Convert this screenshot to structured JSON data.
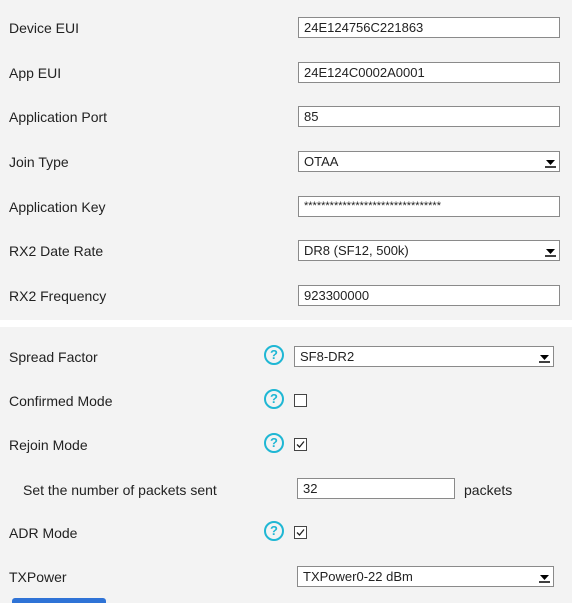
{
  "lorawan": {
    "device_eui": {
      "label": "Device EUI",
      "value": "24E124756C221863"
    },
    "app_eui": {
      "label": "App EUI",
      "value": "24E124C0002A0001"
    },
    "application_port": {
      "label": "Application Port",
      "value": "85"
    },
    "join_type": {
      "label": "Join Type",
      "value": "OTAA"
    },
    "application_key": {
      "label": "Application Key",
      "value": "********************************"
    },
    "rx2_data_rate": {
      "label": "RX2 Date Rate",
      "value": "DR8 (SF12, 500k)"
    },
    "rx2_frequency": {
      "label": "RX2 Frequency",
      "value": "923300000"
    }
  },
  "advanced": {
    "spread_factor": {
      "label": "Spread Factor",
      "value": "SF8-DR2",
      "help": "?"
    },
    "confirmed_mode": {
      "label": "Confirmed Mode",
      "checked": false,
      "help": "?"
    },
    "rejoin_mode": {
      "label": "Rejoin Mode",
      "checked": true,
      "help": "?"
    },
    "packets_sent": {
      "label": "Set the number of packets sent",
      "value": "32",
      "unit": "packets"
    },
    "adr_mode": {
      "label": "ADR Mode",
      "checked": true,
      "help": "?"
    },
    "tx_power": {
      "label": "TXPower",
      "value": "TXPower0-22 dBm"
    }
  }
}
